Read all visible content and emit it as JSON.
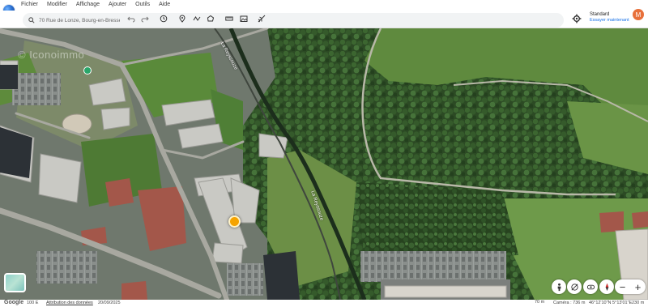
{
  "menu": {
    "items": [
      "Fichier",
      "Modifier",
      "Affichage",
      "Ajouter",
      "Outils",
      "Aide"
    ]
  },
  "search": {
    "value": "70 Rue de Lonze, Bourg-en-Bresse"
  },
  "toolbar": {
    "icons": [
      "undo-icon",
      "redo-icon",
      "history-icon",
      "place-mark-icon",
      "path-icon",
      "polygon-icon",
      "ruler-icon",
      "image-overlay-icon",
      "flight-icon"
    ]
  },
  "account": {
    "style_label": "Standard",
    "try_label": "Essayer maintenant",
    "avatar_initial": "M"
  },
  "map": {
    "river_label_top": "La Reyssouze",
    "river_label_bottom": "La Reyssouze",
    "watermark": "© Iconoimmo"
  },
  "status": {
    "brand": "Google",
    "year": "100 E",
    "attribution": "Attribution des données",
    "date": "20/09/2025",
    "scale": "70 m",
    "camera": "Caméra : 736 m",
    "coords": "46°12'10\"N 5°13'01\"E",
    "altitude": "230 m"
  }
}
